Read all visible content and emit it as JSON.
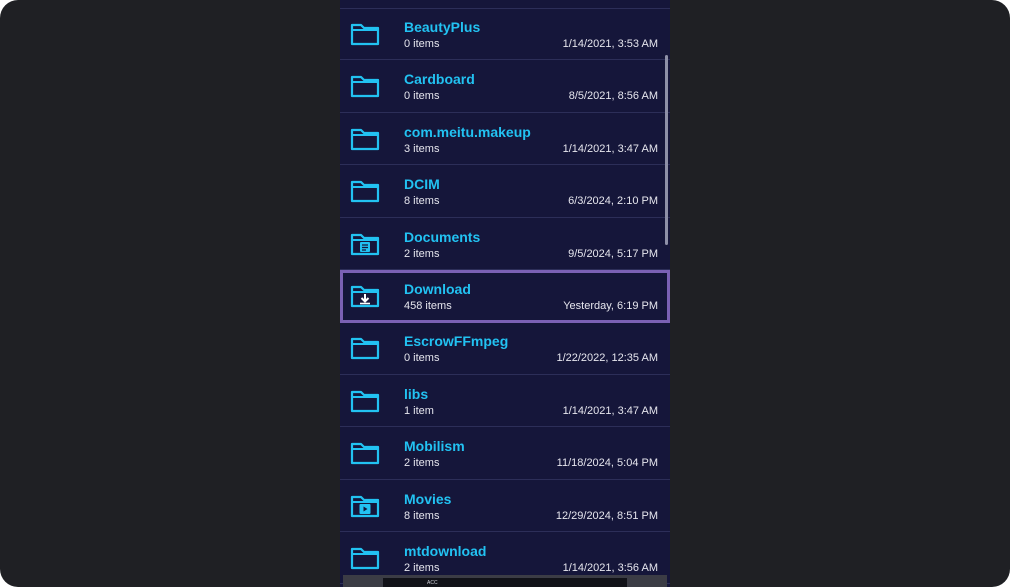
{
  "folders": [
    {
      "name": "BeautyPlus",
      "count": "0 items",
      "date": "1/14/2021, 3:53 AM",
      "icon": "folder-icon"
    },
    {
      "name": "Cardboard",
      "count": "0 items",
      "date": "8/5/2021, 8:56 AM",
      "icon": "folder-icon"
    },
    {
      "name": "com.meitu.makeup",
      "count": "3 items",
      "date": "1/14/2021, 3:47 AM",
      "icon": "folder-icon"
    },
    {
      "name": "DCIM",
      "count": "8 items",
      "date": "6/3/2024, 2:10 PM",
      "icon": "folder-icon"
    },
    {
      "name": "Documents",
      "count": "2 items",
      "date": "9/5/2024, 5:17 PM",
      "icon": "documents-folder-icon"
    },
    {
      "name": "Download",
      "count": "458 items",
      "date": "Yesterday, 6:19 PM",
      "icon": "download-folder-icon",
      "selected": true
    },
    {
      "name": "EscrowFFmpeg",
      "count": "0 items",
      "date": "1/22/2022, 12:35 AM",
      "icon": "folder-icon"
    },
    {
      "name": "libs",
      "count": "1 item",
      "date": "1/14/2021, 3:47 AM",
      "icon": "folder-icon"
    },
    {
      "name": "Mobilism",
      "count": "2 items",
      "date": "11/18/2024, 5:04 PM",
      "icon": "folder-icon"
    },
    {
      "name": "Movies",
      "count": "8 items",
      "date": "12/29/2024, 8:51 PM",
      "icon": "movies-folder-icon"
    },
    {
      "name": "mtdownload",
      "count": "2 items",
      "date": "1/14/2021, 3:56 AM",
      "icon": "folder-icon"
    }
  ],
  "bottom_bar": {
    "label": "ACC"
  },
  "colors": {
    "background": "#1f2024",
    "list_background": "#15163a",
    "folder_name": "#22c2f2",
    "meta_text": "#e6e6ee",
    "highlight_border": "#7b61b5"
  }
}
